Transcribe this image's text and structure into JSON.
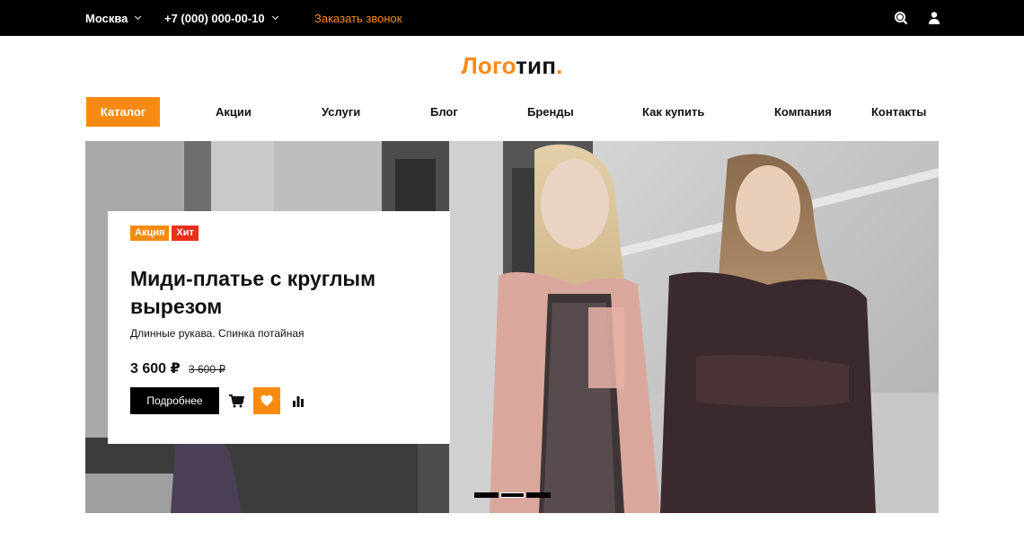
{
  "topbar": {
    "city": "Москва",
    "phone": "+7 (000) 000-00-10",
    "callback": "Заказать звонок",
    "icons": [
      "search-icon",
      "user-icon",
      "chevron-down-icon"
    ]
  },
  "logo": {
    "part1": "Лого",
    "part2": "тип",
    "dot": "."
  },
  "nav": {
    "catalog": "Каталог",
    "items": [
      "Акции",
      "Услуги",
      "Блог",
      "Бренды",
      "Как купить",
      "Компания",
      "Контакты"
    ]
  },
  "hero": {
    "badges": [
      "Акция",
      "Хит"
    ],
    "title": "Миди-платье с круглым вырезом",
    "description": "Длинные рукава. Спинка потайная",
    "price": "3 600 ₽",
    "old_price": "3 600 ₽",
    "more_button": "Подробнее",
    "icons": [
      "cart-icon",
      "heart-icon",
      "compare-icon"
    ],
    "slides": {
      "count": 3,
      "active": 2
    }
  },
  "colors": {
    "accent": "#f78b12",
    "hit_badge": "#e8301a",
    "topbar_bg": "#000000"
  }
}
